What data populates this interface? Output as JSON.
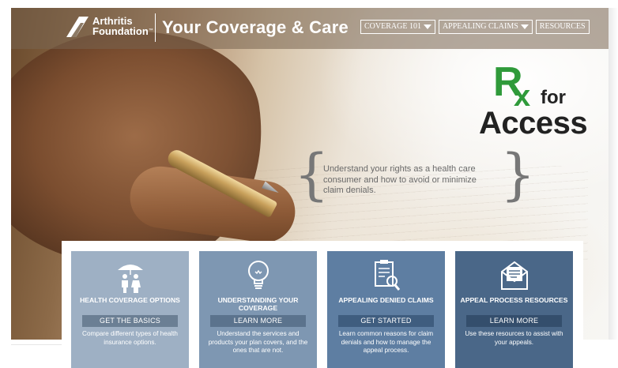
{
  "header": {
    "logo_line1": "Arthritis",
    "logo_line2": "Foundation",
    "logo_tm": "™",
    "site_title": "Your Coverage & Care",
    "nav": [
      {
        "label": "COVERAGE 101",
        "has_dropdown": true
      },
      {
        "label": "APPEALING CLAIMS",
        "has_dropdown": true
      },
      {
        "label": "RESOURCES",
        "has_dropdown": false
      }
    ]
  },
  "hero": {
    "badge": {
      "rx_r": "R",
      "rx_x": "x",
      "for": "for",
      "access": "Access"
    },
    "tagline": "Understand your rights as a health care consumer and how to avoid or minimize claim denials."
  },
  "cards": [
    {
      "title": "HEALTH COVERAGE OPTIONS",
      "cta": "GET THE BASICS",
      "desc": "Compare different types of health insurance options.",
      "icon": "family-umbrella-icon"
    },
    {
      "title": "UNDERSTANDING YOUR COVERAGE",
      "cta": "LEARN MORE",
      "desc": "Understand the services and products your plan covers, and the ones that are not.",
      "icon": "lightbulb-icon"
    },
    {
      "title": "APPEALING DENIED CLAIMS",
      "cta": "GET STARTED",
      "desc": "Learn common reasons for claim denials and how to manage the appeal process.",
      "icon": "clipboard-magnifier-icon"
    },
    {
      "title": "APPEAL PROCESS RESOURCES",
      "cta": "LEARN MORE",
      "desc": "Use these resources to assist with your appeals.",
      "icon": "envelope-letter-icon"
    }
  ],
  "colors": {
    "rx_green": "#2f9a3a",
    "card1": "#9eb0c4",
    "card2": "#7e97b2",
    "card3": "#5e7ea2",
    "card4": "#4a6788"
  }
}
